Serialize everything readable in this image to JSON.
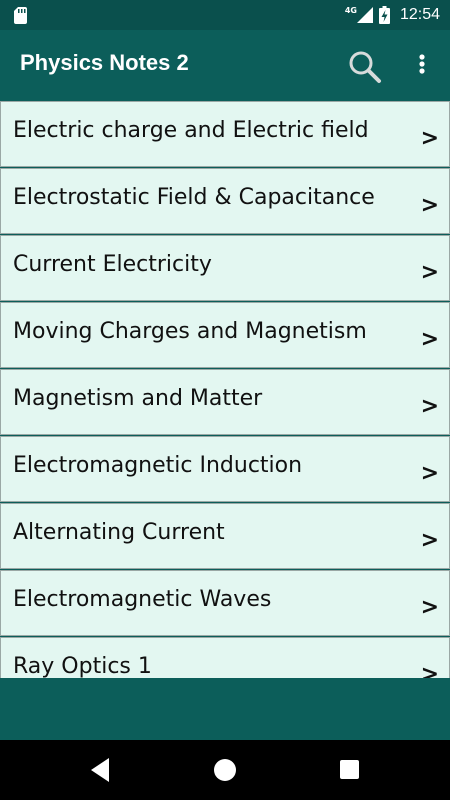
{
  "status_bar": {
    "network_label": "4G",
    "time": "12:54",
    "icons": [
      "sd-card-icon",
      "signal-icon",
      "battery-charging-icon"
    ]
  },
  "app_bar": {
    "title": "Physics Notes 2",
    "icons": [
      "search-icon",
      "more-vert-icon"
    ]
  },
  "topics": {
    "chevron": ">",
    "items": [
      "Electric charge and Electric field",
      "Electrostatic Field & Capacitance",
      "Current Electricity",
      "Moving Charges and Magnetism",
      "Magnetism and Matter",
      "Electromagnetic Induction",
      "Alternating Current",
      "Electromagnetic Waves",
      "Ray Optics 1"
    ]
  },
  "nav_bar": {
    "icons": [
      "back-icon",
      "home-icon",
      "recents-icon"
    ]
  },
  "colors": {
    "primary": "#0c5e5a",
    "status_bar": "#0a504d",
    "row_background": "#e3f7f1",
    "row_border": "#9aa8a5",
    "nav_bar": "#000000"
  }
}
